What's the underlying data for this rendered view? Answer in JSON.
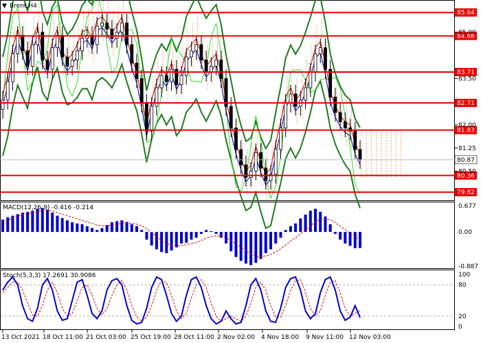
{
  "symbol": "Brent",
  "timeframe": "H4",
  "chart_data": {
    "type": "candlestick",
    "title": "Brent,H4",
    "price_axis": {
      "min": 79.6,
      "max": 86.0,
      "ticks": [
        85.0,
        83.5,
        82.0,
        81.25,
        80.5
      ]
    },
    "levels": [
      85.64,
      84.88,
      83.71,
      82.71,
      81.83,
      80.36,
      79.82
    ],
    "current_price": 80.87,
    "time_labels": [
      "13 Oct 2021",
      "18 Oct 11:00",
      "21 Oct 03:00",
      "25 Oct 19:00",
      "28 Oct 11:00",
      "2 Nov 02:00",
      "4 Nov 18:00",
      "9 Nov 11:00",
      "12 Nov 03:00"
    ],
    "candle_close": [
      82.8,
      83.4,
      84.3,
      84.9,
      84.4,
      83.9,
      84.6,
      85.0,
      84.1,
      83.8,
      84.5,
      84.9,
      84.2,
      83.9,
      84.1,
      84.4,
      84.8,
      84.9,
      84.6,
      85.2,
      85.3,
      85.1,
      84.8,
      85.0,
      85.3,
      84.6,
      84.0,
      83.5,
      82.7,
      81.8,
      82.6,
      83.2,
      83.6,
      83.4,
      83.8,
      83.3,
      83.6,
      84.2,
      84.4,
      84.6,
      84.1,
      83.7,
      83.9,
      84.1,
      83.5,
      82.6,
      81.9,
      81.2,
      80.7,
      80.3,
      80.5,
      81.1,
      80.6,
      80.2,
      80.4,
      81.2,
      81.9,
      82.7,
      83.0,
      82.6,
      82.8,
      83.2,
      83.7,
      84.3,
      84.5,
      83.8,
      82.9,
      82.4,
      82.1,
      81.9,
      81.8,
      81.2,
      80.87
    ],
    "macd": {
      "label": "MACD(12,26,9)",
      "main_value": -0.416,
      "signal_value": -0.214,
      "axis": {
        "min": -0.887,
        "max": 0.677,
        "ticks": [
          0.677,
          0.0,
          -0.887
        ]
      },
      "histogram": [
        0.32,
        0.38,
        0.42,
        0.46,
        0.5,
        0.52,
        0.55,
        0.6,
        0.62,
        0.58,
        0.5,
        0.42,
        0.36,
        0.3,
        0.25,
        0.22,
        0.2,
        0.15,
        0.1,
        0.05,
        0.1,
        0.18,
        0.25,
        0.28,
        0.3,
        0.26,
        0.2,
        0.15,
        0.05,
        -0.2,
        -0.35,
        -0.45,
        -0.52,
        -0.55,
        -0.48,
        -0.4,
        -0.3,
        -0.28,
        -0.2,
        -0.15,
        -0.05,
        0.05,
        0.02,
        -0.05,
        -0.15,
        -0.3,
        -0.5,
        -0.65,
        -0.75,
        -0.82,
        -0.86,
        -0.8,
        -0.7,
        -0.55,
        -0.45,
        -0.3,
        -0.15,
        0.05,
        0.15,
        0.22,
        0.35,
        0.45,
        0.55,
        0.6,
        0.52,
        0.4,
        0.2,
        -0.05,
        -0.2,
        -0.3,
        -0.36,
        -0.42,
        -0.416
      ],
      "signal": [
        0.25,
        0.3,
        0.35,
        0.4,
        0.44,
        0.47,
        0.5,
        0.53,
        0.56,
        0.56,
        0.54,
        0.5,
        0.46,
        0.42,
        0.38,
        0.34,
        0.3,
        0.26,
        0.22,
        0.18,
        0.16,
        0.16,
        0.18,
        0.2,
        0.22,
        0.23,
        0.22,
        0.2,
        0.16,
        0.08,
        -0.02,
        -0.12,
        -0.22,
        -0.3,
        -0.34,
        -0.36,
        -0.35,
        -0.33,
        -0.3,
        -0.27,
        -0.22,
        -0.16,
        -0.12,
        -0.1,
        -0.11,
        -0.15,
        -0.22,
        -0.31,
        -0.4,
        -0.49,
        -0.57,
        -0.62,
        -0.64,
        -0.62,
        -0.58,
        -0.52,
        -0.44,
        -0.34,
        -0.24,
        -0.15,
        -0.05,
        0.06,
        0.16,
        0.26,
        0.32,
        0.34,
        0.32,
        0.24,
        0.15,
        0.06,
        -0.04,
        -0.13,
        -0.214
      ]
    },
    "stochastic": {
      "label": "Stoch(5,3,3)",
      "main_value": 17.2691,
      "signal_value": 30.9086,
      "axis": {
        "min": 0,
        "max": 100,
        "ticks": [
          100,
          80,
          20,
          0
        ]
      },
      "main": [
        70,
        85,
        95,
        80,
        40,
        15,
        10,
        35,
        80,
        92,
        70,
        30,
        12,
        15,
        50,
        85,
        90,
        60,
        25,
        15,
        30,
        70,
        88,
        92,
        80,
        40,
        12,
        5,
        8,
        35,
        75,
        95,
        90,
        60,
        25,
        10,
        20,
        60,
        90,
        95,
        75,
        40,
        15,
        5,
        10,
        30,
        15,
        5,
        8,
        40,
        80,
        92,
        70,
        30,
        10,
        8,
        35,
        75,
        92,
        95,
        70,
        30,
        15,
        25,
        65,
        90,
        95,
        70,
        30,
        12,
        18,
        40,
        17.2691
      ],
      "signal": [
        65,
        75,
        85,
        85,
        70,
        45,
        22,
        20,
        40,
        70,
        85,
        65,
        35,
        20,
        25,
        50,
        75,
        80,
        60,
        35,
        22,
        35,
        60,
        80,
        88,
        70,
        40,
        18,
        10,
        18,
        40,
        70,
        88,
        85,
        60,
        30,
        15,
        25,
        55,
        80,
        90,
        75,
        45,
        20,
        10,
        15,
        20,
        15,
        10,
        20,
        45,
        75,
        85,
        70,
        40,
        18,
        18,
        40,
        70,
        88,
        90,
        65,
        35,
        20,
        30,
        60,
        85,
        88,
        65,
        35,
        20,
        25,
        30.9086
      ]
    }
  }
}
